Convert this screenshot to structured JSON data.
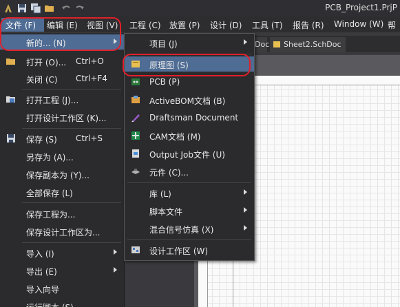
{
  "window": {
    "title": "PCB_Project1.PrjP"
  },
  "menubar": [
    "文件 (F)",
    "编辑 (E)",
    "视图 (V)",
    "工程 (C)",
    "放置 (P)",
    "设计 (D)",
    "工具 (T)",
    "报告 (R)",
    "Window (W)",
    "帮"
  ],
  "tabs": {
    "t1": "Doc",
    "t2": "Sheet2.SchDoc"
  },
  "file_menu": {
    "new": "新的... (N)",
    "open": "打开 (O)...",
    "open_sc": "Ctrl+O",
    "close": "关闭 (C)",
    "close_sc": "Ctrl+F4",
    "open_project": "打开工程 (J)...",
    "open_workspace": "打开设计工作区 (K)...",
    "save": "保存 (S)",
    "save_sc": "Ctrl+S",
    "save_as": "另存为 (A)...",
    "save_copy": "保存副本为 (Y)...",
    "save_all": "全部保存 (L)",
    "save_project_as": "保存工程为...",
    "save_workspace_as": "保存设计工作区为...",
    "import": "导入 (I)",
    "export": "导出 (E)",
    "import_wizard": "导入向导",
    "run_script": "运行脚本 (S)..."
  },
  "new_submenu": {
    "project": "项目 (J)",
    "schematic": "原理图 (S)",
    "pcb": "PCB (P)",
    "activebom": "ActiveBOM文档 (B)",
    "draftsman": "Draftsman Document",
    "cam": "CAM文档 (M)",
    "output_job": "Output Job文件 (U)",
    "component": "元件 (C)...",
    "library": "库 (L)",
    "script": "脚本文件",
    "mixed_sim": "混合信号仿真 (X)",
    "workspace": "设计工作区 (W)"
  },
  "colors": {
    "highlight": "#4e6c94",
    "annotation": "#e0202a"
  }
}
